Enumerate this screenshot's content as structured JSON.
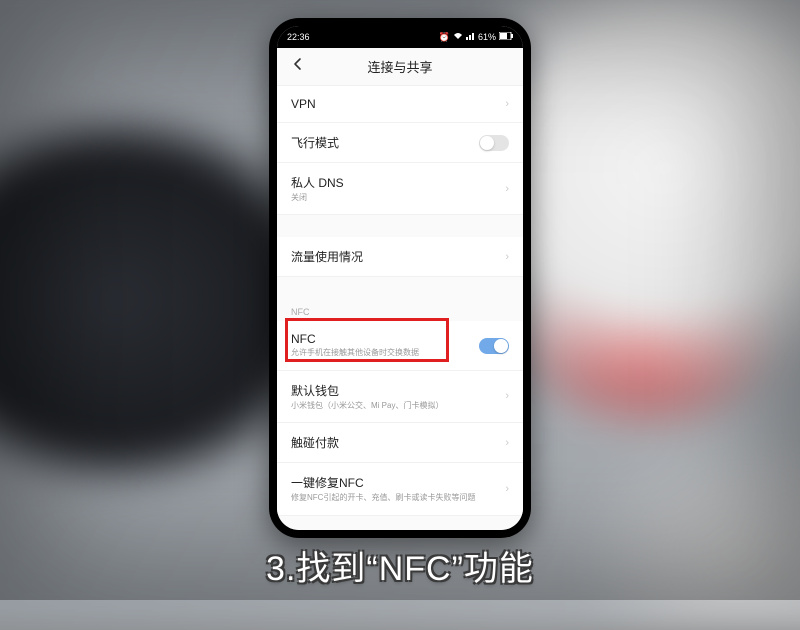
{
  "status": {
    "time": "22:36",
    "battery": "61%"
  },
  "page_title": "连接与共享",
  "rows": {
    "vpn": {
      "label": "VPN"
    },
    "airplane": {
      "label": "飞行模式"
    },
    "dns": {
      "label": "私人 DNS",
      "sub": "关闭"
    },
    "data_usage": {
      "label": "流量使用情况"
    }
  },
  "nfc_section": {
    "header": "NFC",
    "nfc": {
      "label": "NFC",
      "sub": "允许手机在接触其他设备时交换数据",
      "on": true
    },
    "wallet": {
      "label": "默认钱包",
      "sub": "小米钱包（小米公交、Mi Pay、门卡模拟）"
    },
    "tap_pay": {
      "label": "触碰付款"
    },
    "repair": {
      "label": "一键修复NFC",
      "sub": "修复NFC引起的开卡、充值、刷卡或读卡失败等问题"
    }
  },
  "caption": "3.找到“NFC”功能"
}
